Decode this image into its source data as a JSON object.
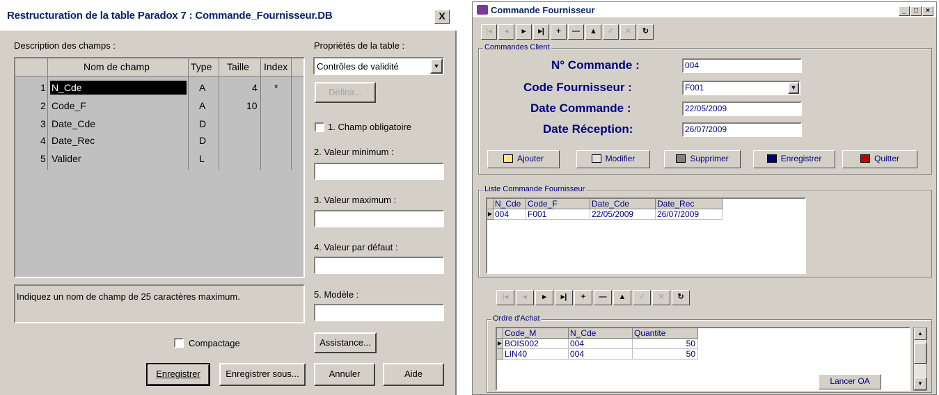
{
  "left_dialog": {
    "title": "Restructuration de la table Paradox 7 : Commande_Fournisseur.DB",
    "close_label": "X",
    "fields_label": "Description des champs :",
    "columns": {
      "name": "Nom de champ",
      "type": "Type",
      "size": "Taille",
      "index": "Index"
    },
    "rows": [
      {
        "num": "1",
        "name": "N_Cde",
        "type": "A",
        "size": "4",
        "index": "*"
      },
      {
        "num": "2",
        "name": "Code_F",
        "type": "A",
        "size": "10",
        "index": ""
      },
      {
        "num": "3",
        "name": "Date_Cde",
        "type": "D",
        "size": "",
        "index": ""
      },
      {
        "num": "4",
        "name": "Date_Rec",
        "type": "D",
        "size": "",
        "index": ""
      },
      {
        "num": "5",
        "name": "Valider",
        "type": "L",
        "size": "",
        "index": ""
      }
    ],
    "status_text": "Indiquez un nom de champ de 25 caractères maximum.",
    "props_label": "Propriétés de la table :",
    "props_selected": "Contrôles de validité",
    "define_button": "Définir...",
    "required_label": "1. Champ obligatoire",
    "min_label": "2. Valeur minimum :",
    "max_label": "3. Valeur maximum :",
    "default_label": "4. Valeur par défaut :",
    "model_label": "5. Modèle :",
    "assist_button": "Assistance...",
    "compact_label": "Compactage",
    "save_button": "Enregistrer",
    "save_as_button": "Enregistrer sous...",
    "cancel_button": "Annuler",
    "help_button": "Aide"
  },
  "right_window": {
    "title": "Commande Fournisseur",
    "group_client": "Commandes Client",
    "order_no_label": "N° Commande :",
    "order_no_value": "004",
    "supplier_label": "Code Fournisseur :",
    "supplier_value": "F001",
    "order_date_label": "Date Commande :",
    "order_date_value": "22/05/2009",
    "receipt_date_label": "Date Réception:",
    "receipt_date_value": "26/07/2009",
    "btn_add": "Ajouter",
    "btn_edit": "Modifier",
    "btn_delete": "Supprimer",
    "btn_save": "Enregistrer",
    "btn_quit": "Quitter",
    "group_list": "Liste Commande Fournisseur",
    "list_columns": [
      "N_Cde",
      "Code_F",
      "Date_Cde",
      "Date_Rec"
    ],
    "list_rows": [
      [
        "004",
        "F001",
        "22/05/2009",
        "26/07/2009"
      ]
    ],
    "group_purchase": "Ordre d'Achat",
    "purchase_columns": [
      "Code_M",
      "N_Cde",
      "Quantite"
    ],
    "purchase_rows": [
      [
        "BOIS002",
        "004",
        "50"
      ],
      [
        "LIN40",
        "004",
        "50"
      ]
    ],
    "launch_button": "Lancer OA"
  }
}
